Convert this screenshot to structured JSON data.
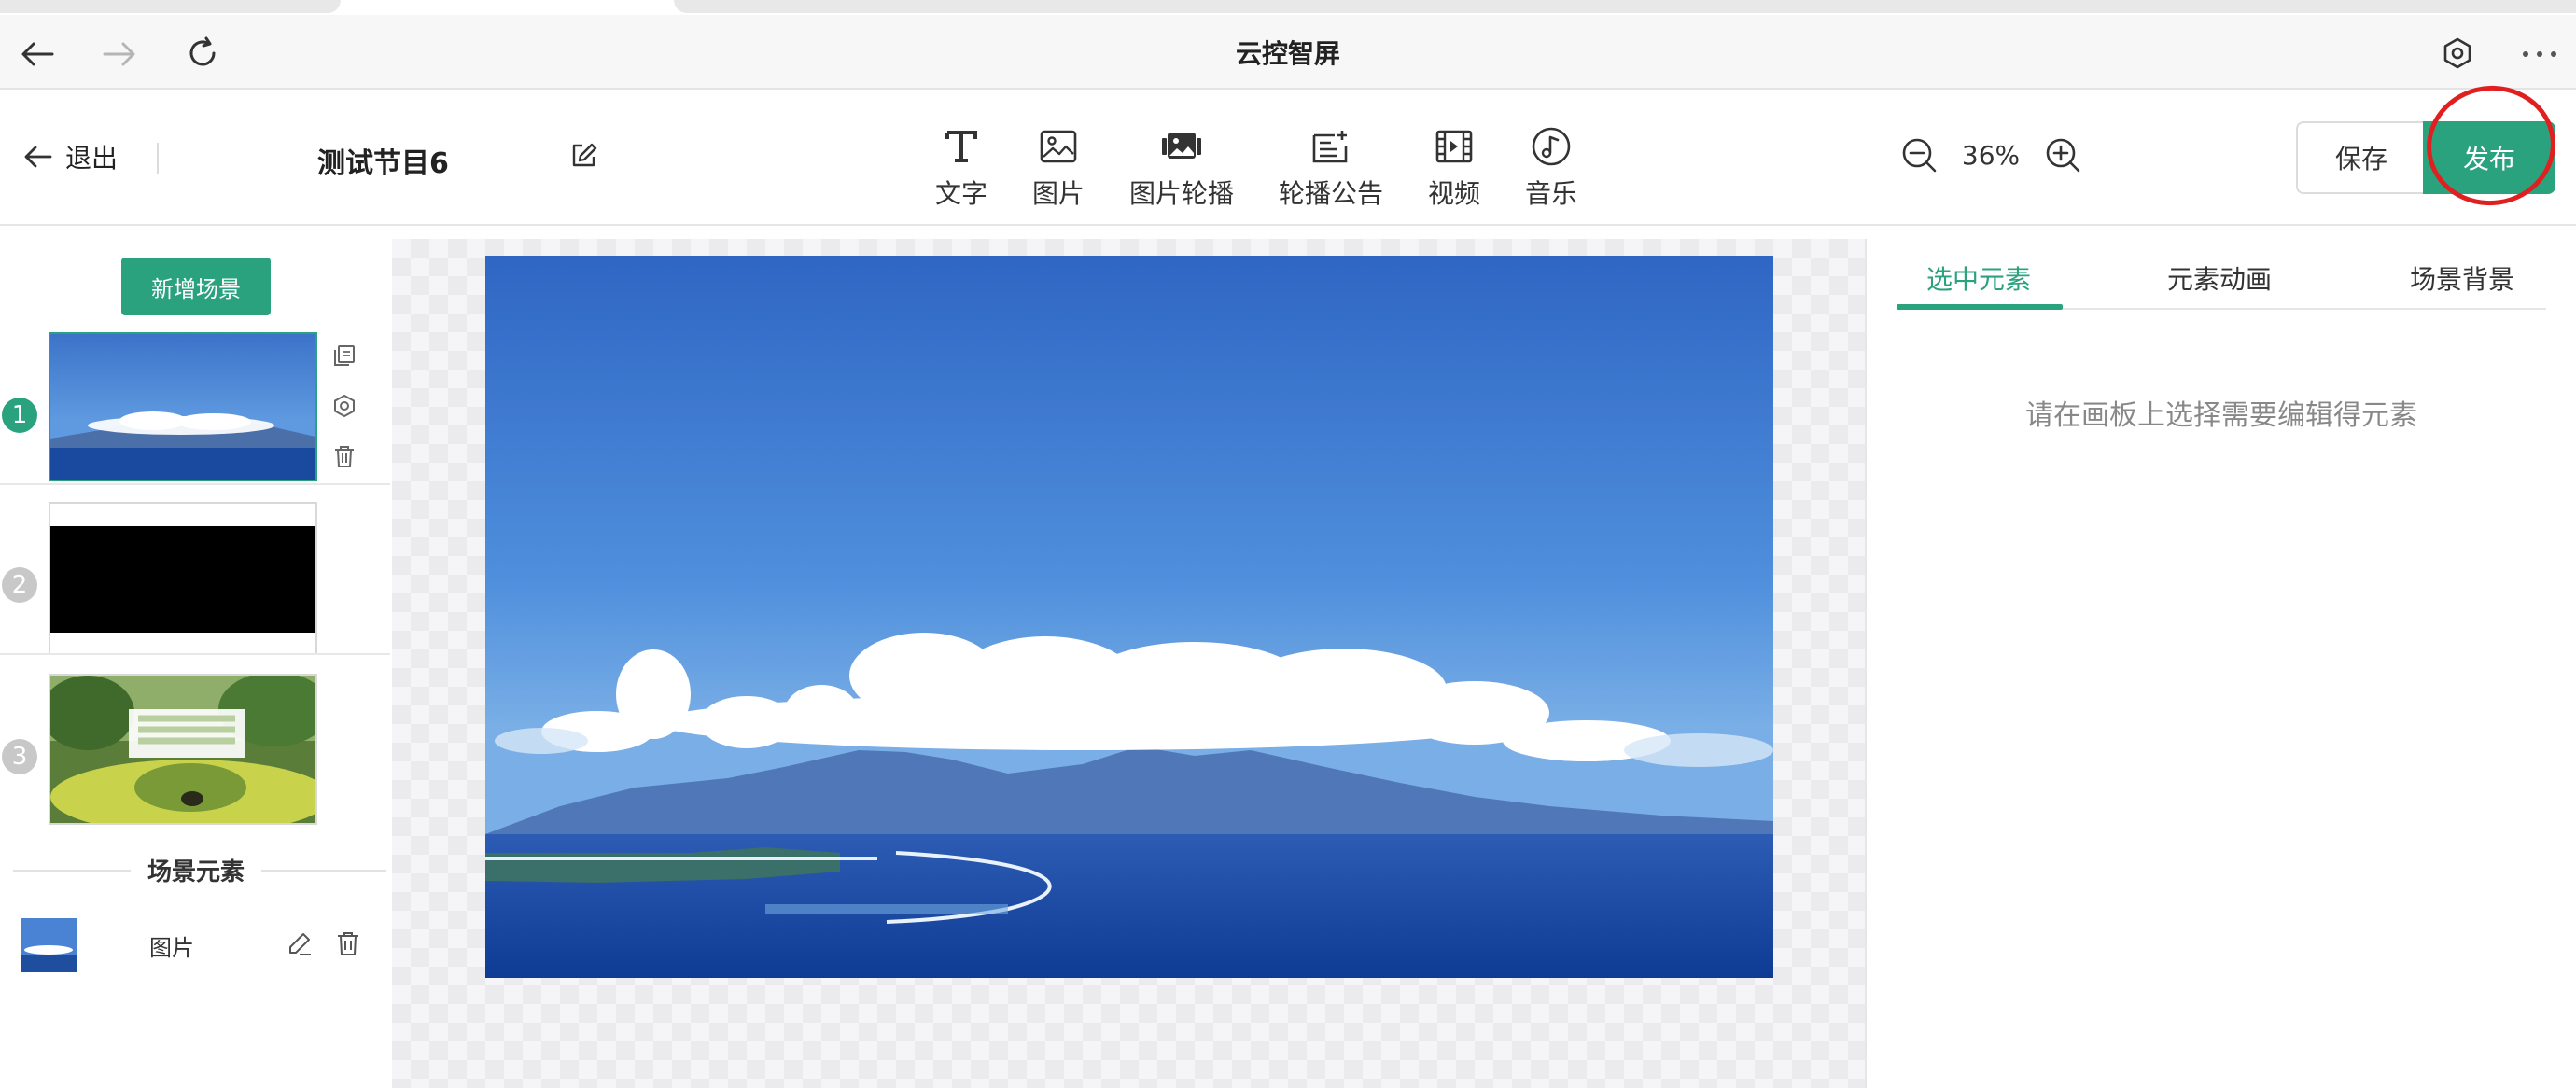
{
  "browser": {
    "title": "云控智屏",
    "back_icon": "arrow-left-icon",
    "forward_icon": "arrow-right-icon",
    "reload_icon": "reload-icon",
    "settings_icon": "hexagon-gear-icon",
    "more_icon": "ellipsis-icon"
  },
  "toolbar": {
    "exit_label": "退出",
    "program_title": "测试节目6",
    "tools": [
      {
        "label": "文字",
        "icon": "text-T-icon"
      },
      {
        "label": "图片",
        "icon": "image-icon"
      },
      {
        "label": "图片轮播",
        "icon": "image-carousel-icon"
      },
      {
        "label": "轮播公告",
        "icon": "notice-carousel-icon"
      },
      {
        "label": "视频",
        "icon": "film-icon"
      },
      {
        "label": "音乐",
        "icon": "music-note-icon"
      }
    ],
    "zoom": "36%",
    "save_label": "保存",
    "publish_label": "发布"
  },
  "left_panel": {
    "add_scene_label": "新增场景",
    "scenes": [
      {
        "number": "1",
        "active": true
      },
      {
        "number": "2",
        "active": false
      },
      {
        "number": "3",
        "active": false
      }
    ],
    "elements_title": "场景元素",
    "elements": [
      {
        "label": "图片"
      }
    ]
  },
  "right_panel": {
    "tabs": [
      "选中元素",
      "元素动画",
      "场景背景"
    ],
    "active_tab": 0,
    "empty_hint": "请在画板上选择需要编辑得元素"
  },
  "colors": {
    "accent": "#2aa27e",
    "highlight_circle": "#e02020",
    "inactive_number": "#c8c8c8"
  }
}
